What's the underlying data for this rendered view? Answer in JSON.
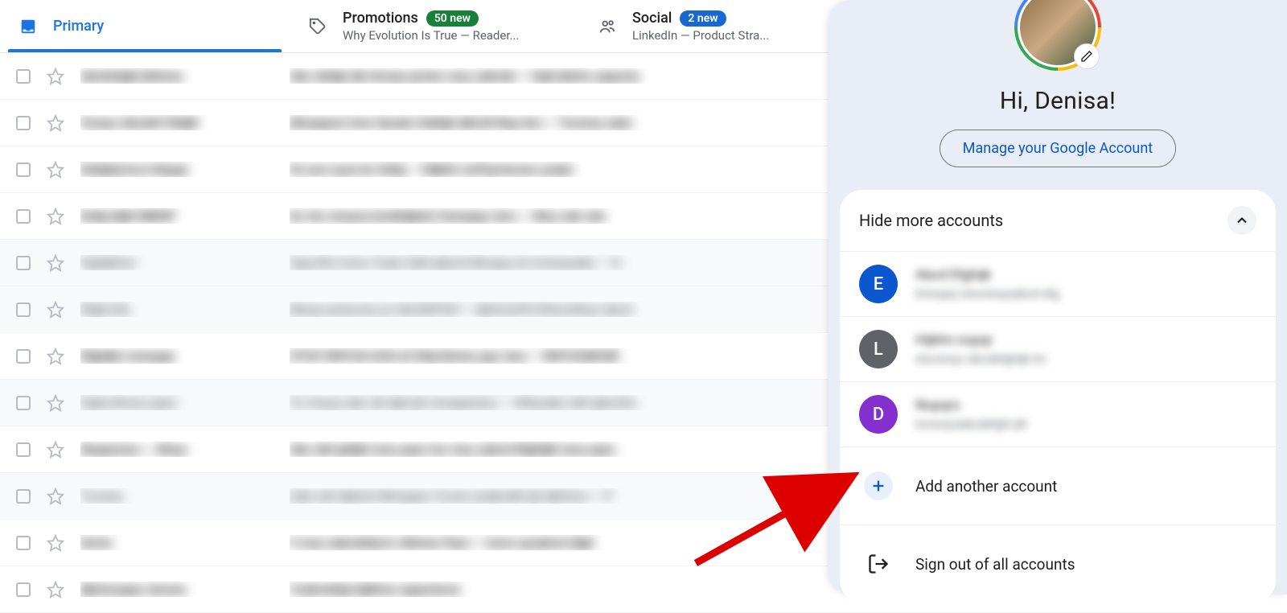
{
  "tabs": {
    "primary": {
      "label": "Primary"
    },
    "promotions": {
      "label": "Promotions",
      "badge": "50 new",
      "subtitle": "Why Evolution Is True — Reader..."
    },
    "social": {
      "label": "Social",
      "badge": "2 new",
      "subtitle": "LinkedIn — Product Stra..."
    }
  },
  "account_panel": {
    "greeting": "Hi, Denisa!",
    "manage_btn": "Manage your Google Account",
    "hide_label": "Hide more accounts",
    "accounts": [
      {
        "letter": "E",
        "color": "blue"
      },
      {
        "letter": "L",
        "color": "gray"
      },
      {
        "letter": "D",
        "color": "purple"
      }
    ],
    "add_label": "Add another account",
    "signout_label": "Sign out of all accounts"
  }
}
